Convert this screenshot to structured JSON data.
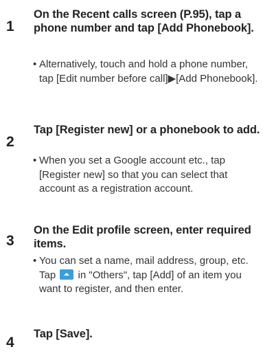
{
  "steps": [
    {
      "number": "1",
      "title": "On the Recent calls screen (P.95), tap a phone number and tap [Add Phonebook].",
      "bullet": "Alternatively, touch and hold a phone number, tap [Edit number before call]▶[Add Phonebook]."
    },
    {
      "number": "2",
      "title": "Tap [Register new] or a phonebook to add.",
      "bullet": "When you set a Google account etc., tap [Register new] so that you can select that account as a registration account."
    },
    {
      "number": "3",
      "title": "On the Edit profile screen, enter required items.",
      "bullet_before_icon": "You can set a name, mail address, group, etc. Tap",
      "bullet_icon": "collapse-up-icon",
      "bullet_after_icon": "in \"Others\", tap [Add] of an item you want to register, and then enter."
    },
    {
      "number": "4",
      "title": "Tap [Save]."
    }
  ],
  "colors": {
    "icon_blue": "#3b9fd9"
  }
}
